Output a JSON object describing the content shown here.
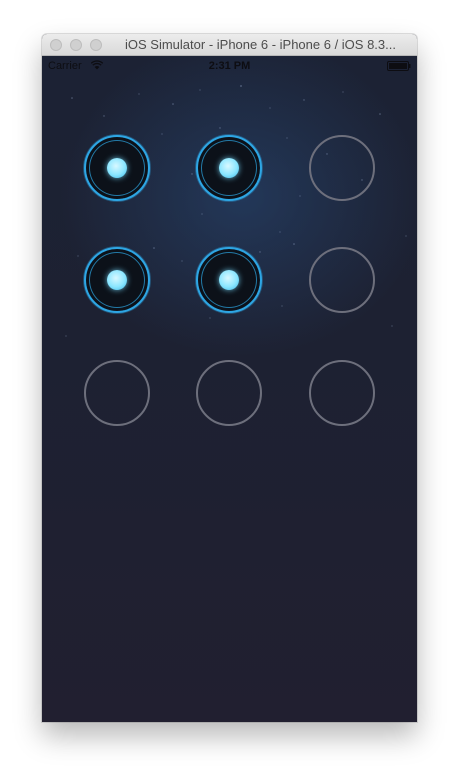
{
  "window": {
    "title": "iOS Simulator - iPhone 6 - iPhone 6 / iOS 8.3..."
  },
  "statusbar": {
    "carrier": "Carrier",
    "time": "2:31 PM",
    "wifi_icon": "wifi-icon",
    "battery_icon": "battery-icon"
  },
  "pattern": {
    "rows": 3,
    "cols": 3,
    "selected": [
      [
        true,
        true,
        false
      ],
      [
        true,
        true,
        false
      ],
      [
        false,
        false,
        false
      ]
    ],
    "colors": {
      "active_ring": "#2ea6e4",
      "active_dot": "#8ae6ff",
      "inactive_ring": "#6d6f7c",
      "background": "#1d2132"
    }
  }
}
